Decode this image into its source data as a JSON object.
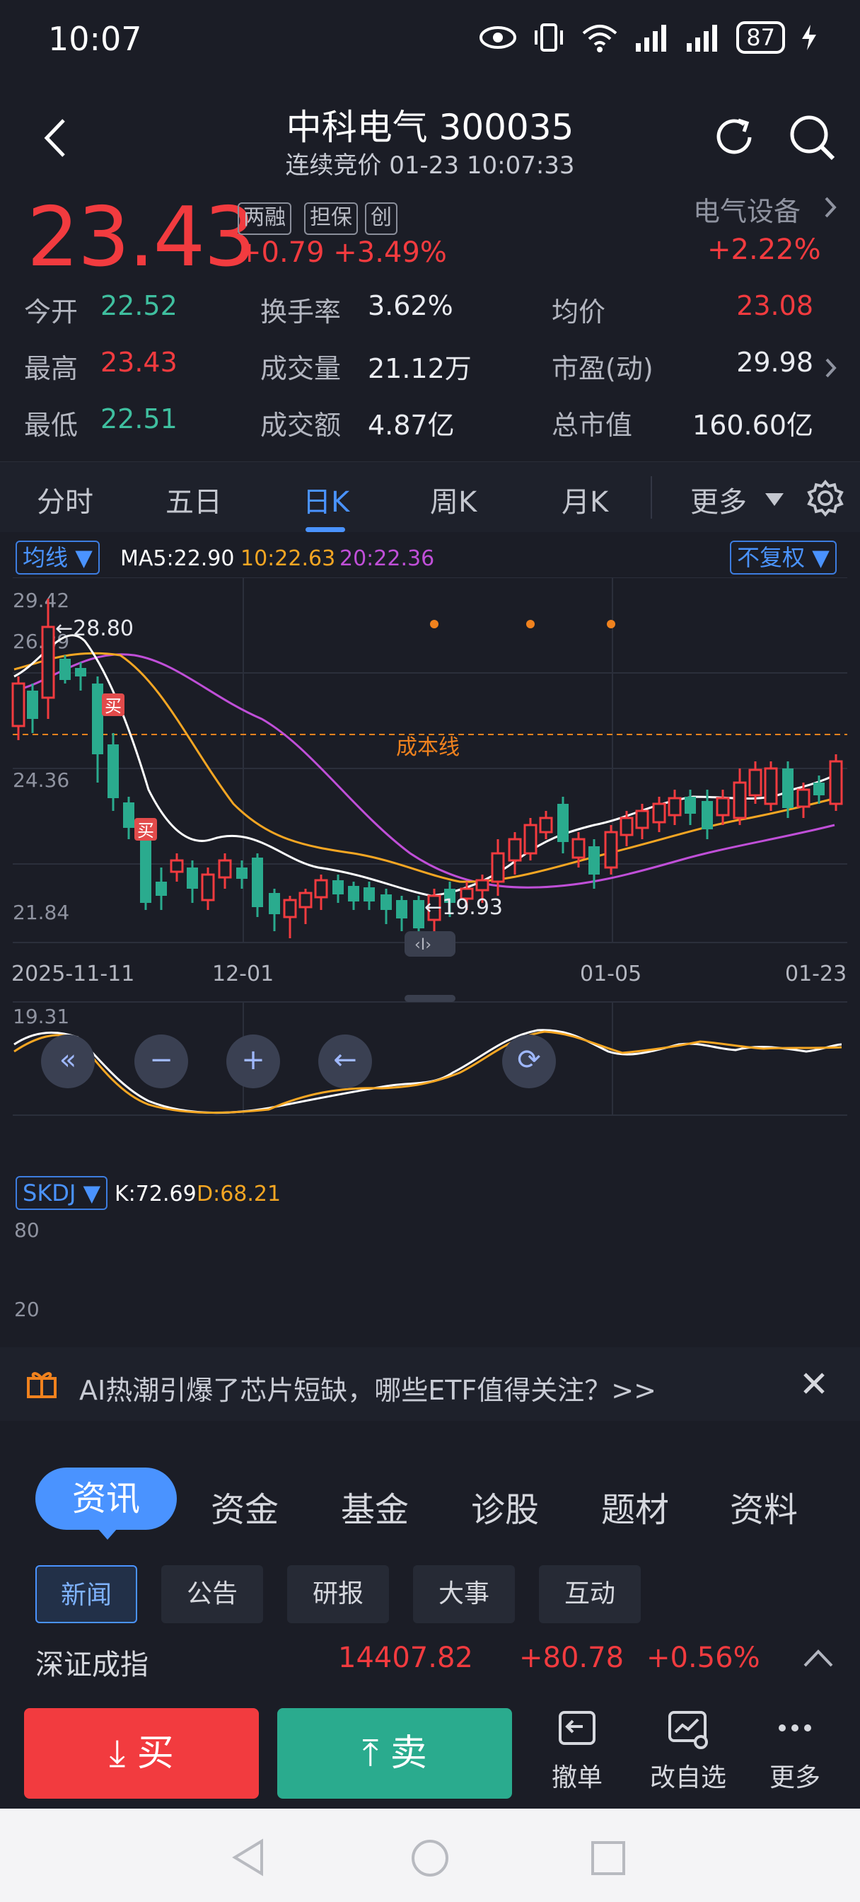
{
  "status_bar": {
    "time": "10:07",
    "battery": "87"
  },
  "header": {
    "title": "中科电气 300035",
    "subtitle": "连续竞价 01-23 10:07:33"
  },
  "quote": {
    "price": "23.43",
    "tags": [
      "两融",
      "担保",
      "创"
    ],
    "change": "+0.79 +3.49%",
    "sector_name": "电气设备",
    "sector_change": "+2.22%",
    "stats": [
      [
        {
          "label": "今开",
          "value": "22.52",
          "tone": "green"
        },
        {
          "label": "换手率",
          "value": "3.62%",
          "tone": "white"
        },
        {
          "label": "均价",
          "value": "23.08",
          "tone": "red"
        }
      ],
      [
        {
          "label": "最高",
          "value": "23.43",
          "tone": "red"
        },
        {
          "label": "成交量",
          "value": "21.12万",
          "tone": "white"
        },
        {
          "label": "市盈(动)",
          "value": "29.98",
          "tone": "white"
        }
      ],
      [
        {
          "label": "最低",
          "value": "22.51",
          "tone": "green"
        },
        {
          "label": "成交额",
          "value": "4.87亿",
          "tone": "white"
        },
        {
          "label": "总市值",
          "value": "160.60亿",
          "tone": "white"
        }
      ]
    ]
  },
  "kline_tabs": {
    "items": [
      "分时",
      "五日",
      "日K",
      "周K",
      "月K",
      "更多"
    ],
    "active": "日K"
  },
  "chart": {
    "ma_selector": "均线",
    "ma5": "MA5:22.90",
    "ma10": "10:22.63",
    "ma20": "20:22.36",
    "adjust": "不复权",
    "y_ticks": [
      "29.42",
      "26.89",
      "24.36",
      "21.84",
      "19.31"
    ],
    "x_ticks": [
      "2025-11-11",
      "12-01",
      "01-05",
      "01-23"
    ],
    "high_marker": "←28.80",
    "low_marker": "←19.93",
    "buy_marker": "买",
    "cost_line_label": "成本线",
    "colors": {
      "up": "#f23b3f",
      "down": "#2aab8e",
      "ma5": "#ffffff",
      "ma10": "#f5a623",
      "ma20": "#c04fd8",
      "cost": "#f0821e"
    }
  },
  "chart_data": {
    "type": "candlestick",
    "indicator": "SKDJ",
    "k_label": "K:72.69",
    "d_label": "D:68.21",
    "indicator_ticks": [
      "80",
      "20"
    ]
  },
  "news_banner": {
    "text": "AI热潮引爆了芯片短缺，哪些ETF值得关注？>>"
  },
  "info": {
    "tabs": [
      "资讯",
      "资金",
      "基金",
      "诊股",
      "题材",
      "资料"
    ],
    "subtabs": [
      "新闻",
      "公告",
      "研报",
      "大事",
      "互动"
    ],
    "index": {
      "name": "深证成指",
      "value": "14407.82",
      "change": "+80.78",
      "pct": "+0.56%"
    }
  },
  "trade": {
    "buy": "买",
    "sell": "卖",
    "tools": [
      "撤单",
      "改自选",
      "更多"
    ]
  }
}
